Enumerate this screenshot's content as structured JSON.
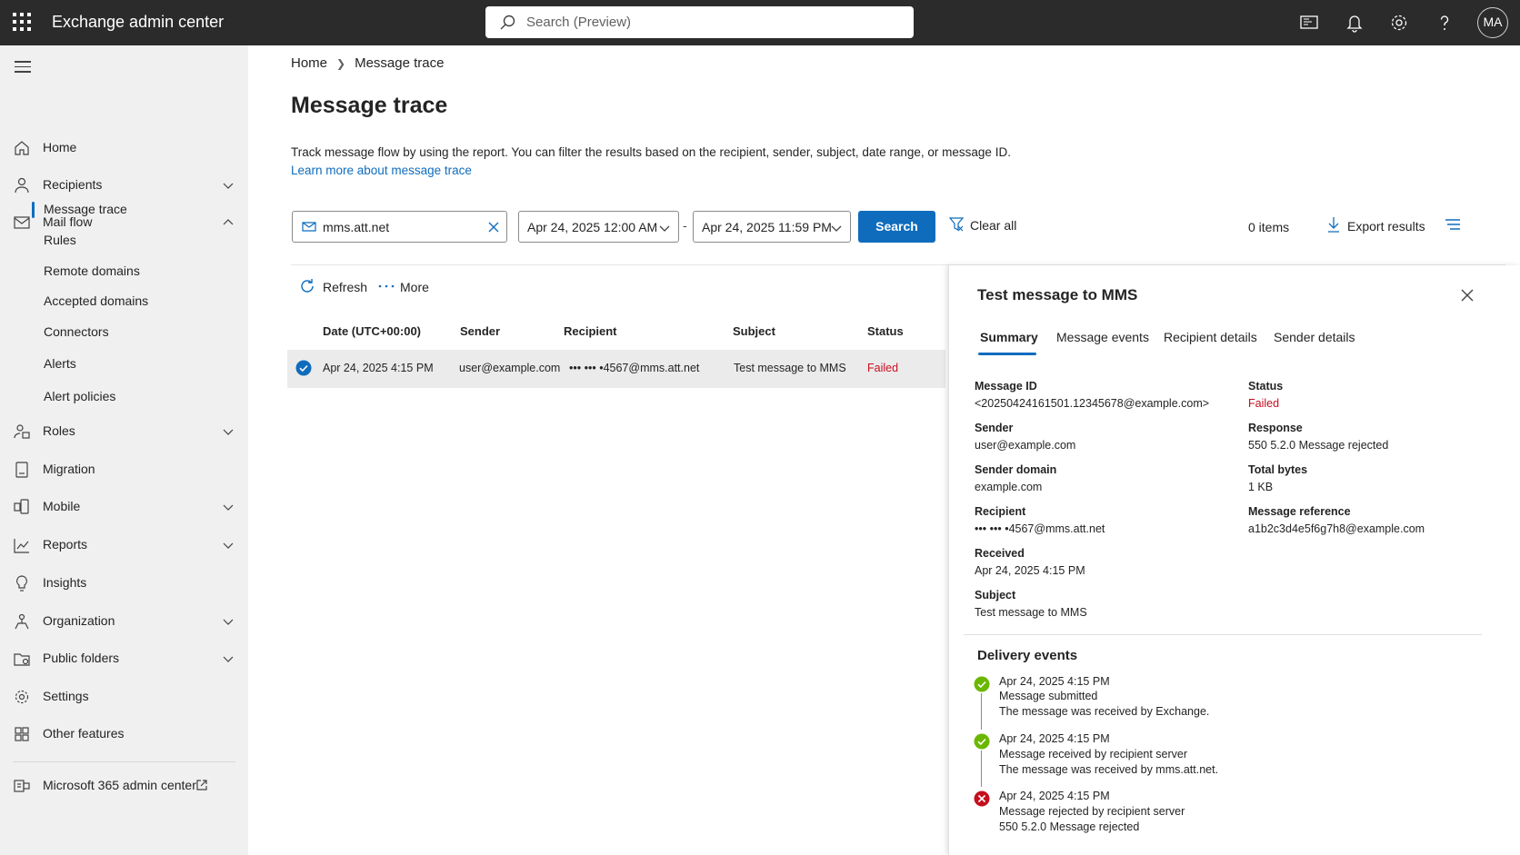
{
  "app": {
    "title": "Exchange admin center",
    "avatar_initials": "MA"
  },
  "search": {
    "placeholder": "Search (Preview)"
  },
  "sidebar": {
    "items": [
      {
        "label": "Home",
        "icon": "home-icon"
      },
      {
        "label": "Recipients",
        "icon": "person-icon",
        "expandable": true
      },
      {
        "label": "Mail flow",
        "icon": "mail-icon",
        "expandable": true,
        "expanded": true
      },
      {
        "label": "Roles",
        "icon": "roles-icon",
        "expandable": true
      },
      {
        "label": "Migration",
        "icon": "migration-icon"
      },
      {
        "label": "Mobile",
        "icon": "mobile-icon",
        "expandable": true
      },
      {
        "label": "Reports",
        "icon": "chart-icon",
        "expandable": true
      },
      {
        "label": "Insights",
        "icon": "lightbulb-icon"
      },
      {
        "label": "Organization",
        "icon": "organization-icon",
        "expandable": true
      },
      {
        "label": "Public folders",
        "icon": "folder-icon",
        "expandable": true
      },
      {
        "label": "Settings",
        "icon": "gear-icon"
      },
      {
        "label": "Other features",
        "icon": "grid-icon"
      }
    ],
    "mailflow_subitems": [
      "Message trace",
      "Rules",
      "Remote domains",
      "Accepted domains",
      "Connectors",
      "Alerts",
      "Alert policies"
    ],
    "admin_center_link": "Microsoft 365 admin center"
  },
  "breadcrumb": {
    "home": "Home",
    "current": "Message trace"
  },
  "page": {
    "title": "Message trace",
    "description": "Track message flow by using the report. You can filter the results based on the recipient, sender, subject, date range, or message ID.",
    "learn_more": "Learn more about message trace"
  },
  "filters": {
    "recipient_value": "mms.att.net",
    "start_date": "Apr 24, 2025 12:00 AM",
    "dash": "-",
    "end_date": "Apr 24, 2025 11:59 PM",
    "search_label": "Search",
    "clear_all_label": "Clear all",
    "items_count": "0 items",
    "export_label": "Export results"
  },
  "commands": {
    "refresh": "Refresh",
    "more": "More"
  },
  "table": {
    "headers": [
      "Date (UTC+00:00)",
      "Sender",
      "Recipient",
      "Subject",
      "Status"
    ],
    "rows": [
      {
        "date": "Apr 24, 2025 4:15 PM",
        "sender": "user@example.com",
        "recipient": "••• ••• •4567@mms.att.net",
        "subject": "Test message to MMS",
        "status": "Failed",
        "selected": true
      }
    ]
  },
  "details": {
    "title": "Test message to MMS",
    "tabs": [
      "Summary",
      "Message events",
      "Recipient details",
      "Sender details"
    ],
    "active_tab": "Summary",
    "left_fields": [
      {
        "label": "Message ID",
        "value": "<20250424161501.12345678@example.com>"
      },
      {
        "label": "Sender",
        "value": "user@example.com"
      },
      {
        "label": "Sender domain",
        "value": "example.com"
      },
      {
        "label": "Recipient",
        "value": "••• ••• •4567@mms.att.net"
      },
      {
        "label": "Received",
        "value": "Apr 24, 2025 4:15 PM"
      },
      {
        "label": "Subject",
        "value": "Test message to MMS"
      }
    ],
    "right_fields": [
      {
        "label": "Status",
        "value": "Failed"
      },
      {
        "label": "Response",
        "value": "550 5.2.0 Message rejected"
      },
      {
        "label": "Total bytes",
        "value": "1 KB"
      },
      {
        "label": "Message reference",
        "value": "a1b2c3d4e5f6g7h8@example.com"
      }
    ],
    "delivery_title": "Delivery events",
    "events": [
      {
        "time": "Apr 24, 2025 4:15 PM",
        "event": "Message submitted",
        "detail": "The message was received by Exchange.",
        "result": "success"
      },
      {
        "time": "Apr 24, 2025 4:15 PM",
        "event": "Message received by recipient server",
        "detail": "The message was received by mms.att.net.",
        "result": "success"
      },
      {
        "time": "Apr 24, 2025 4:15 PM",
        "event": "Message rejected by recipient server",
        "detail": "550 5.2.0 Message rejected",
        "result": "failure"
      }
    ]
  },
  "colors": {
    "accent": "#0f6cbd",
    "topbar": "#2b2b2b",
    "sidebar": "#f0f0f0",
    "failed": "#c50f1f",
    "success": "#6bb700"
  }
}
